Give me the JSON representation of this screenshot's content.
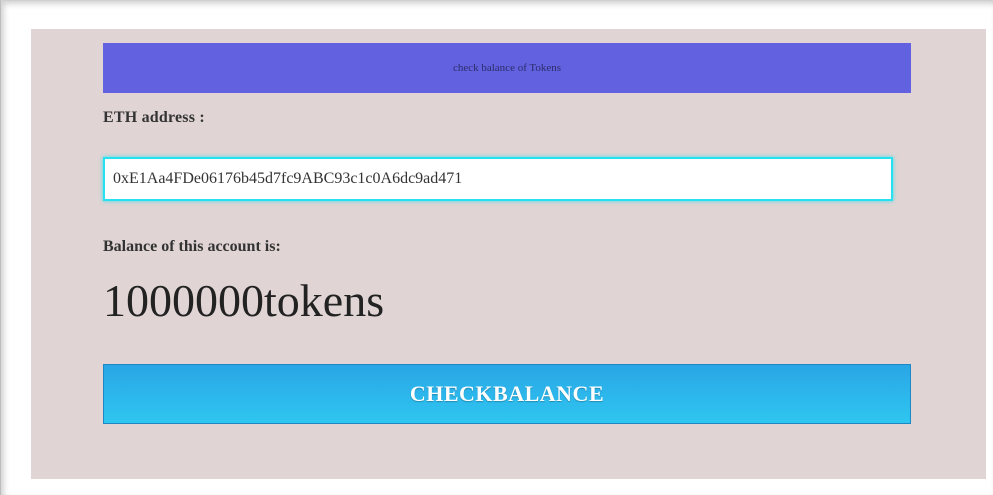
{
  "header": {
    "title": "check balance of Tokens"
  },
  "form": {
    "eth_label": "ETH address :",
    "eth_address": "0xE1Aa4FDe06176b45d7fc9ABC93c1c0A6dc9ad471",
    "balance_label": "Balance of this account is:",
    "balance_value": "1000000tokens",
    "button_label": "CHECKBALANCE"
  },
  "colors": {
    "panel_background": "#e0d4d4",
    "header_background": "#6262e0",
    "input_border": "#27e0f0",
    "button_background": "#2ec6f0"
  }
}
